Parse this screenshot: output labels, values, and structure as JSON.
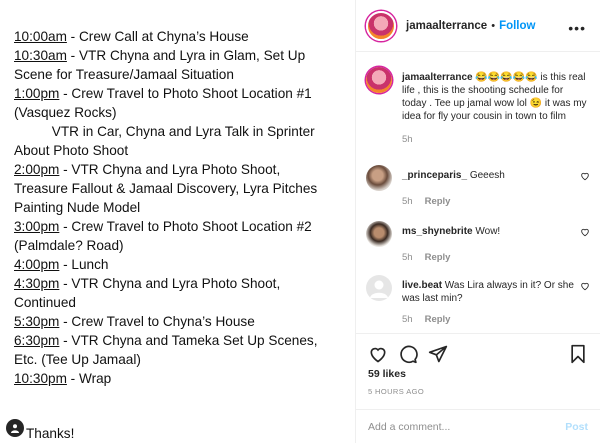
{
  "schedule": [
    {
      "time": "10:00am",
      "text": " - Crew Call at Chyna’s House"
    },
    {
      "time": "10:30am",
      "text": " - VTR Chyna and Lyra in Glam, Set Up"
    },
    {
      "time": "",
      "text": "Scene for Treasure/Jamaal Situation"
    },
    {
      "time": "1:00pm",
      "text": " - Crew Travel to Photo Shoot Location #1"
    },
    {
      "time": "",
      "text": "(Vasquez Rocks)"
    },
    {
      "time": "",
      "text": "          VTR in Car, Chyna and Lyra Talk in Sprinter"
    },
    {
      "time": "",
      "text": "About Photo Shoot"
    },
    {
      "time": "2:00pm",
      "text": " - VTR Chyna and Lyra Photo Shoot,"
    },
    {
      "time": "",
      "text": "Treasure Fallout & Jamaal Discovery, Lyra Pitches"
    },
    {
      "time": "",
      "text": "Painting Nude Model"
    },
    {
      "time": "3:00pm",
      "text": " - Crew Travel to Photo Shoot Location #2"
    },
    {
      "time": "",
      "text": "(Palmdale? Road)"
    },
    {
      "time": "4:00pm",
      "text": " - Lunch"
    },
    {
      "time": "4:30pm",
      "text": " - VTR Chyna and Lyra Photo Shoot,"
    },
    {
      "time": "",
      "text": "Continued"
    },
    {
      "time": "5:30pm",
      "text": " - Crew Travel to Chyna’s House"
    },
    {
      "time": "6:30pm",
      "text": " - VTR Chyna and Tameka Set Up Scenes,"
    },
    {
      "time": "",
      "text": "Etc. (Tee Up Jamaal)"
    },
    {
      "time": "10:30pm",
      "text": " - Wrap"
    },
    {
      "time": "",
      "text": "Thanks!"
    }
  ],
  "header": {
    "username": "jamaalterrance",
    "dot": "•",
    "follow_label": "Follow"
  },
  "caption": {
    "username": "jamaalterrance",
    "text": " 😂😂😂😂😂 is this real life , this is the shooting schedule for today . Tee up jamal wow lol 😉 it was my idea for fly your cousin in town to film",
    "age": "5h"
  },
  "comments": [
    {
      "username": "_princeparis_",
      "text": " Geeesh",
      "age": "5h",
      "reply_label": "Reply"
    },
    {
      "username": "ms_shynebrite",
      "text": " Wow!",
      "age": "5h",
      "reply_label": "Reply"
    },
    {
      "username": "live.beat",
      "text": " Was Lira always in it? Or she was last min?",
      "age": "5h",
      "reply_label": "Reply"
    }
  ],
  "actions": {
    "likes": "59 likes",
    "timestamp": "5 HOURS AGO",
    "comment_placeholder": "Add a comment...",
    "post_label": "Post"
  },
  "colors": {
    "accent": "#0095f6",
    "post_disabled": "#b2dffc",
    "muted": "#8e8e8e"
  }
}
